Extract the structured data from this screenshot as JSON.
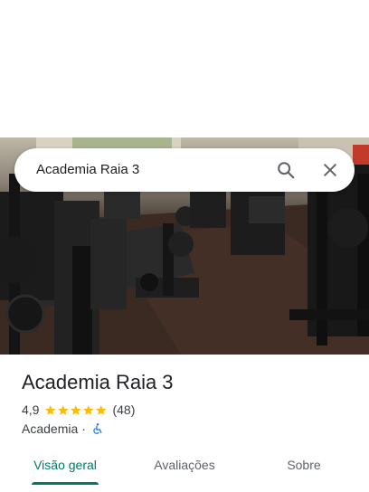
{
  "search": {
    "query": "Academia Raia 3"
  },
  "place": {
    "name": "Academia Raia 3",
    "rating": "4,9",
    "star_count": 5,
    "review_count": "(48)",
    "category": "Academia",
    "separator": "·"
  },
  "tabs": [
    {
      "label": "Visão geral",
      "active": true
    },
    {
      "label": "Avaliações",
      "active": false
    },
    {
      "label": "Sobre",
      "active": false
    }
  ],
  "colors": {
    "accent": "#00796b",
    "star": "#fbbc04",
    "accessibility": "#1a73e8"
  },
  "icons": {
    "search": "search-icon",
    "close": "close-icon",
    "star": "star-icon",
    "accessibility": "wheelchair-icon"
  }
}
